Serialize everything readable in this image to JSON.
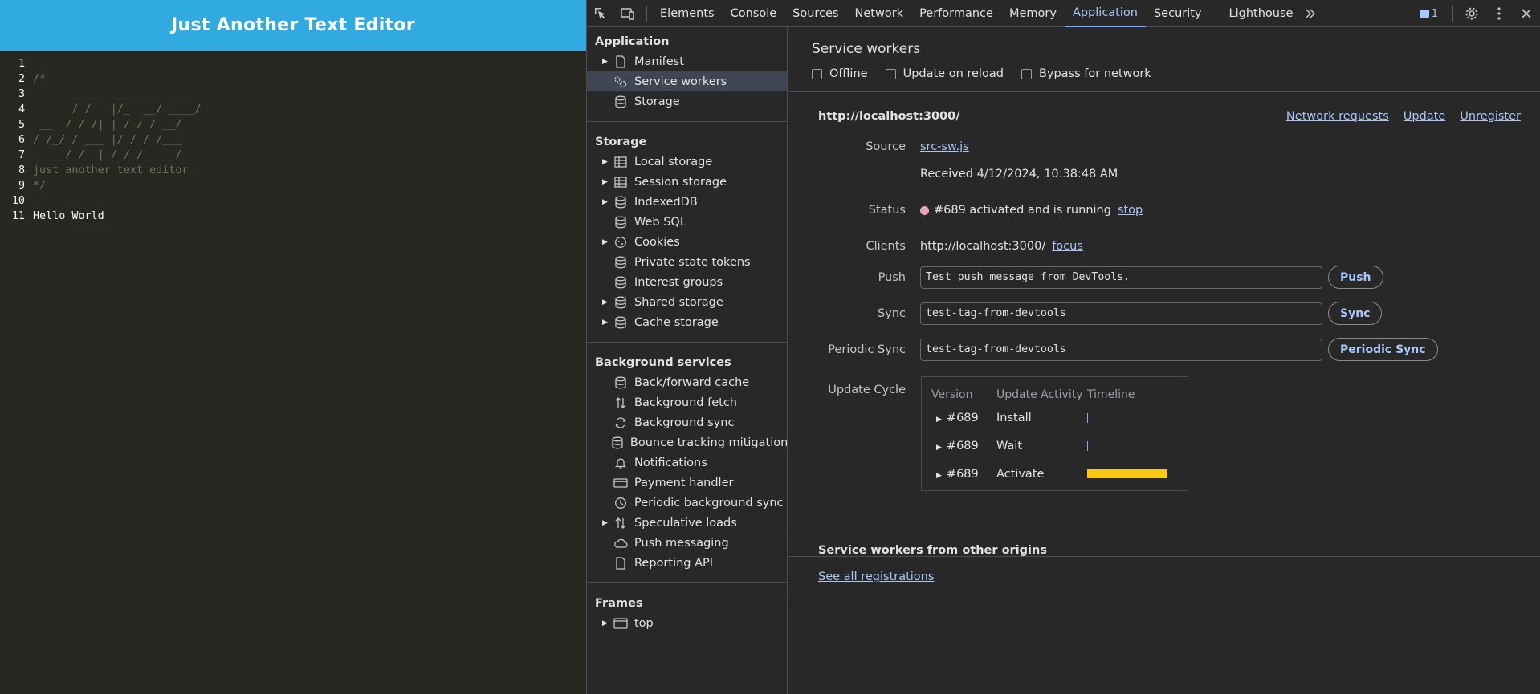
{
  "page": {
    "title": "Just Another Text Editor",
    "editor_lines": [
      {
        "num": "1",
        "text": "",
        "plain": false
      },
      {
        "num": "2",
        "text": "/*",
        "plain": false
      },
      {
        "num": "3",
        "text": "      _____  _______ ____",
        "plain": false
      },
      {
        "num": "4",
        "text": "      / /   |/_  __/ ____/",
        "plain": false
      },
      {
        "num": "5",
        "text": " __  / / /| | / / / __/",
        "plain": false
      },
      {
        "num": "6",
        "text": "/ /_/ / ___ |/ / / /___",
        "plain": false
      },
      {
        "num": "7",
        "text": " ____/_/  |_/_/ /_____/",
        "plain": false
      },
      {
        "num": "8",
        "text": "just another text editor",
        "plain": false
      },
      {
        "num": "9",
        "text": "*/",
        "plain": false
      },
      {
        "num": "10",
        "text": "",
        "plain": false
      },
      {
        "num": "11",
        "text": "Hello World",
        "plain": true
      }
    ]
  },
  "devtools": {
    "tabs": [
      "Elements",
      "Console",
      "Sources",
      "Network",
      "Performance",
      "Memory",
      "Application",
      "Security",
      "Lighthouse"
    ],
    "active_tab": "Application",
    "issues_count": "1",
    "sidebar": {
      "application": {
        "title": "Application",
        "items": [
          {
            "label": "Manifest",
            "arrow": true,
            "icon": "file-icon"
          },
          {
            "label": "Service workers",
            "arrow": false,
            "icon": "gears-icon",
            "selected": true
          },
          {
            "label": "Storage",
            "arrow": false,
            "icon": "database-icon"
          }
        ]
      },
      "storage": {
        "title": "Storage",
        "items": [
          {
            "label": "Local storage",
            "arrow": true,
            "icon": "table-icon"
          },
          {
            "label": "Session storage",
            "arrow": true,
            "icon": "table-icon"
          },
          {
            "label": "IndexedDB",
            "arrow": true,
            "icon": "database-icon"
          },
          {
            "label": "Web SQL",
            "arrow": false,
            "icon": "database-icon"
          },
          {
            "label": "Cookies",
            "arrow": true,
            "icon": "cookie-icon"
          },
          {
            "label": "Private state tokens",
            "arrow": false,
            "icon": "database-icon"
          },
          {
            "label": "Interest groups",
            "arrow": false,
            "icon": "database-icon"
          },
          {
            "label": "Shared storage",
            "arrow": true,
            "icon": "database-icon"
          },
          {
            "label": "Cache storage",
            "arrow": true,
            "icon": "database-icon"
          }
        ]
      },
      "background": {
        "title": "Background services",
        "items": [
          {
            "label": "Back/forward cache",
            "arrow": false,
            "icon": "database-icon"
          },
          {
            "label": "Background fetch",
            "arrow": false,
            "icon": "arrows-updown-icon"
          },
          {
            "label": "Background sync",
            "arrow": false,
            "icon": "sync-icon"
          },
          {
            "label": "Bounce tracking mitigations",
            "arrow": false,
            "icon": "database-icon"
          },
          {
            "label": "Notifications",
            "arrow": false,
            "icon": "bell-icon"
          },
          {
            "label": "Payment handler",
            "arrow": false,
            "icon": "card-icon"
          },
          {
            "label": "Periodic background sync",
            "arrow": false,
            "icon": "clock-icon"
          },
          {
            "label": "Speculative loads",
            "arrow": true,
            "icon": "arrows-updown-icon"
          },
          {
            "label": "Push messaging",
            "arrow": false,
            "icon": "cloud-icon"
          },
          {
            "label": "Reporting API",
            "arrow": false,
            "icon": "file-icon"
          }
        ]
      },
      "frames": {
        "title": "Frames",
        "items": [
          {
            "label": "top",
            "arrow": true,
            "icon": "frame-icon"
          }
        ]
      }
    },
    "service_workers": {
      "title": "Service workers",
      "options": [
        "Offline",
        "Update on reload",
        "Bypass for network"
      ],
      "origin": "http://localhost:3000/",
      "origin_links": [
        "Network requests",
        "Update",
        "Unregister"
      ],
      "source_label": "Source",
      "source_link": "src-sw.js",
      "received": "Received 4/12/2024, 10:38:48 AM",
      "status_label": "Status",
      "status_text": "#689 activated and is running",
      "status_action": "stop",
      "clients_label": "Clients",
      "clients_url": "http://localhost:3000/",
      "clients_action": "focus",
      "push_label": "Push",
      "push_value": "Test push message from DevTools.",
      "push_button": "Push",
      "sync_label": "Sync",
      "sync_value": "test-tag-from-devtools",
      "sync_button": "Sync",
      "periodic_label": "Periodic Sync",
      "periodic_value": "test-tag-from-devtools",
      "periodic_button": "Periodic Sync",
      "update_cycle_label": "Update Cycle",
      "cycle_headers": [
        "Version",
        "Update Activity",
        "Timeline"
      ],
      "cycle_rows": [
        {
          "version": "#689",
          "activity": "Install",
          "timeline": "tick"
        },
        {
          "version": "#689",
          "activity": "Wait",
          "timeline": "tick"
        },
        {
          "version": "#689",
          "activity": "Activate",
          "timeline": "bar"
        }
      ],
      "other_origins_title": "Service workers from other origins",
      "see_all_link": "See all registrations"
    },
    "colors": {
      "header_blue": "#31a9e1",
      "accent": "#a8c7fa",
      "timeline_bar": "#f9c812",
      "status_dot": "#e8a2c0"
    }
  }
}
